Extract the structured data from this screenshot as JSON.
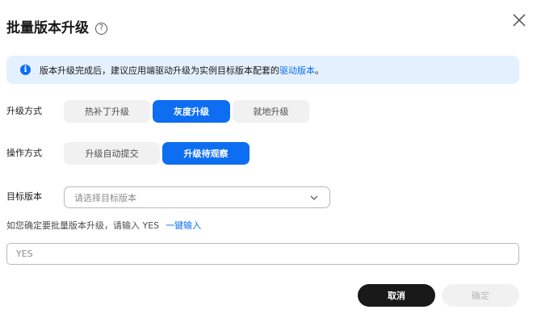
{
  "dialog": {
    "title": "批量版本升级",
    "help_icon": "?",
    "close_icon": "close-icon"
  },
  "alert": {
    "icon": "i",
    "text": "版本升级完成后，建议应用端驱动升级为实例目标版本配套的",
    "link": "驱动版本",
    "suffix": "。"
  },
  "upgrade_method": {
    "label": "升级方式",
    "options": [
      "热补丁升级",
      "灰度升级",
      "就地升级"
    ],
    "selected": "灰度升级"
  },
  "operation_method": {
    "label": "操作方式",
    "options": [
      "升级自动提交",
      "升级待观察"
    ],
    "selected": "升级待观察"
  },
  "target_version": {
    "label": "目标版本",
    "placeholder": "请选择目标版本"
  },
  "confirm": {
    "text": "如您确定要批量版本升级，请输入 YES",
    "link": "一键输入",
    "input_placeholder": "YES"
  },
  "footer": {
    "cancel_label": "取消",
    "ok_label": "确定"
  },
  "colors": {
    "primary": "#0d6ef2",
    "alert_bg": "#e4f0fe",
    "segment_bg": "#f1f1f1",
    "cancel_bg": "#191919"
  }
}
